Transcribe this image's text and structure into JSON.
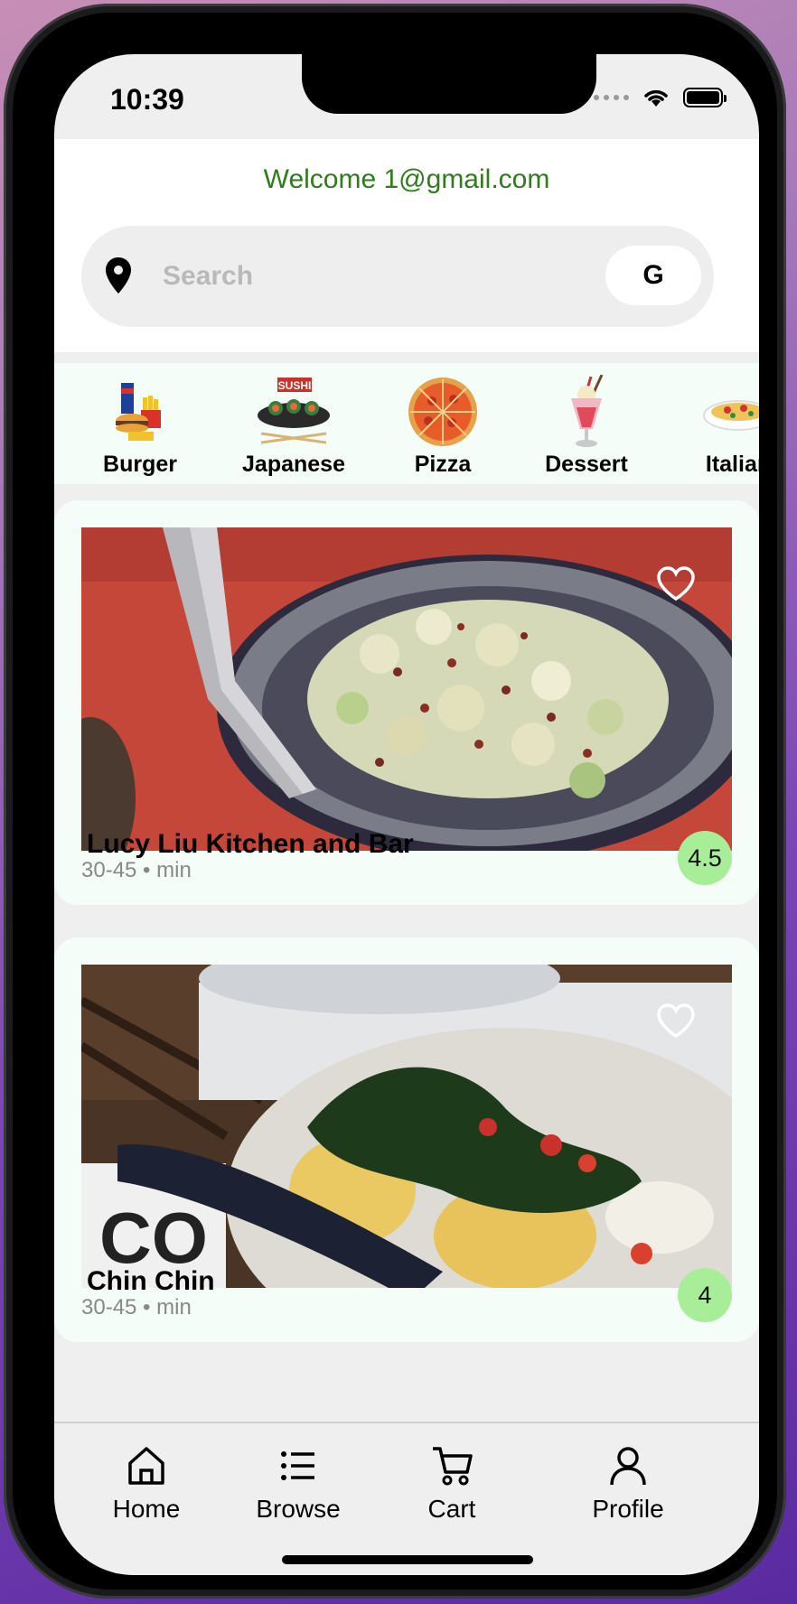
{
  "status": {
    "time": "10:39"
  },
  "header": {
    "welcome": "Welcome 1@gmail.com"
  },
  "search": {
    "placeholder": "Search",
    "google_label": "G"
  },
  "categories": [
    {
      "label": "Burger"
    },
    {
      "label": "Japanese"
    },
    {
      "label": "Pizza"
    },
    {
      "label": "Dessert"
    },
    {
      "label": "Italian"
    }
  ],
  "restaurants": [
    {
      "name": "Lucy Liu Kitchen and Bar",
      "time": "30-45 • min",
      "rating": "4.5"
    },
    {
      "name": "Chin Chin",
      "time": "30-45 • min",
      "rating": "4"
    }
  ],
  "tabs": [
    {
      "label": "Home",
      "icon": "home-icon"
    },
    {
      "label": "Browse",
      "icon": "list-icon"
    },
    {
      "label": "Cart",
      "icon": "cart-icon"
    },
    {
      "label": "Profile",
      "icon": "person-icon"
    }
  ],
  "colors": {
    "welcome": "#2e7d1a",
    "rating_badge": "#a8ee98",
    "category_bg": "#f4fdf8"
  }
}
